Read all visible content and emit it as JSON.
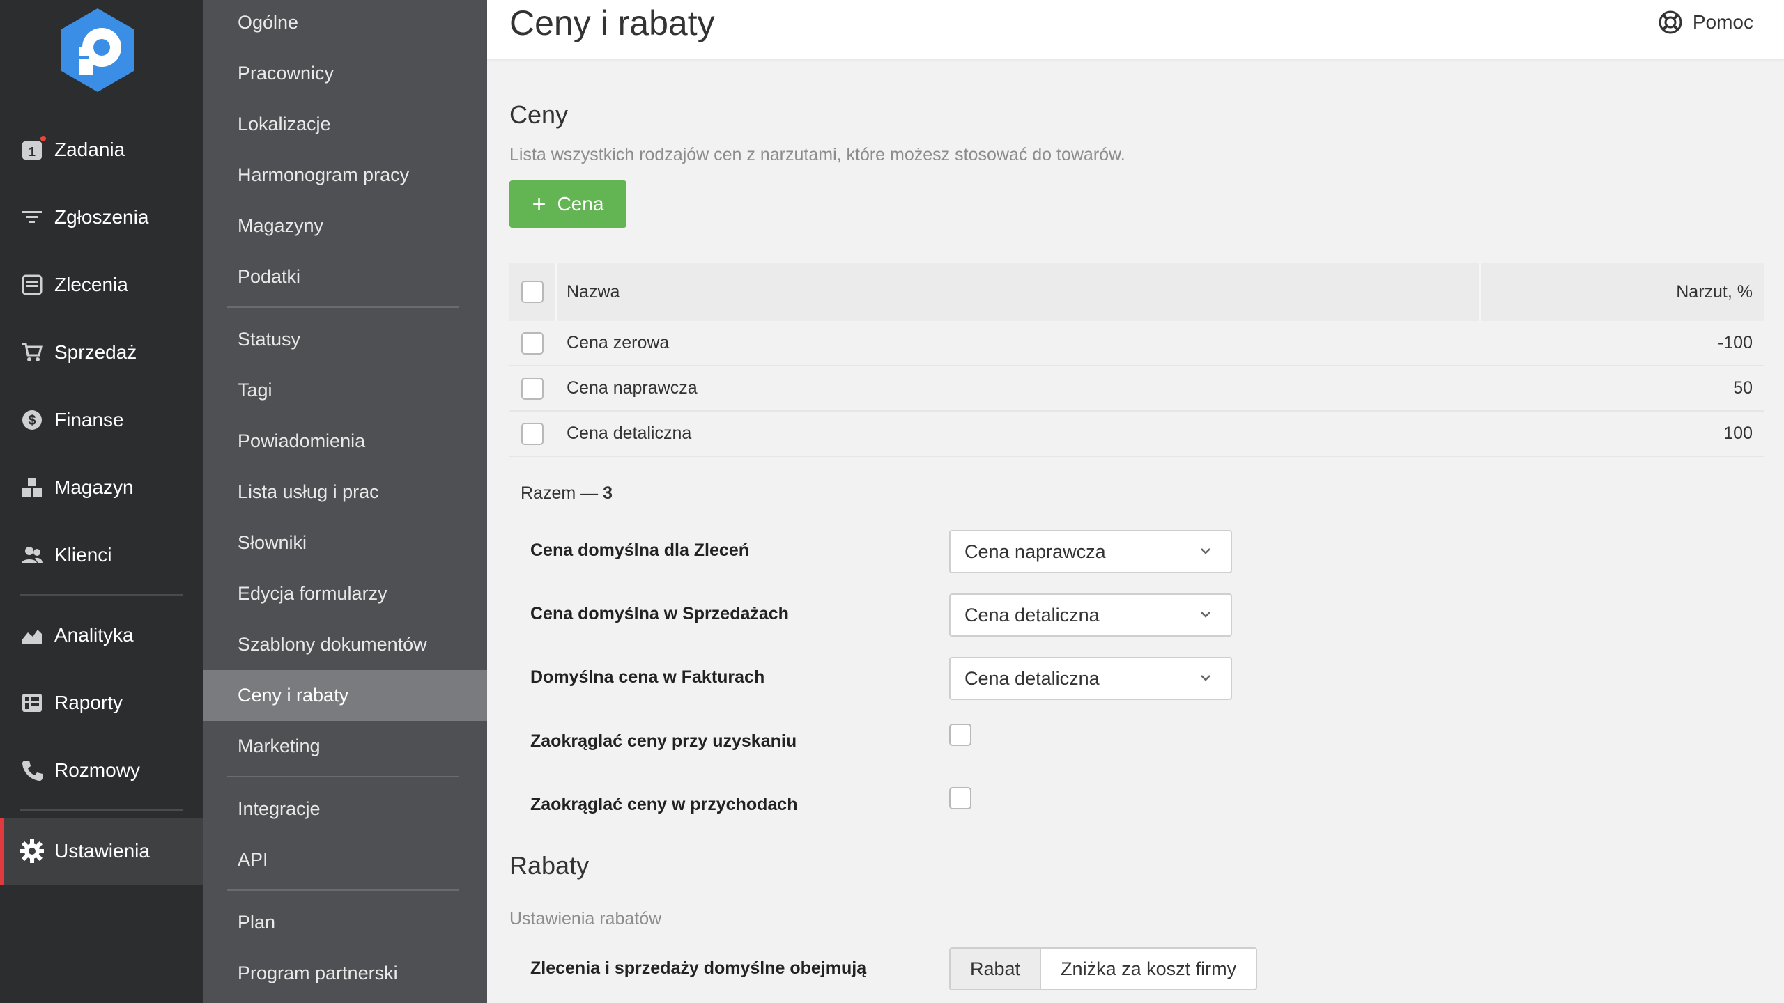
{
  "nav": {
    "items": [
      {
        "label": "Zadania",
        "icon": "tasks-icon",
        "badge": "1"
      },
      {
        "label": "Zgłoszenia",
        "icon": "funnel-icon"
      },
      {
        "label": "Zlecenia",
        "icon": "inbox-icon"
      },
      {
        "label": "Sprzedaż",
        "icon": "cart-icon"
      },
      {
        "label": "Finanse",
        "icon": "dollar-icon"
      },
      {
        "label": "Magazyn",
        "icon": "boxes-icon"
      },
      {
        "label": "Klienci",
        "icon": "users-icon"
      },
      {
        "label": "Analityka",
        "icon": "chart-area-icon"
      },
      {
        "label": "Raporty",
        "icon": "report-icon"
      },
      {
        "label": "Rozmowy",
        "icon": "phone-icon"
      },
      {
        "label": "Ustawienia",
        "icon": "gear-icon",
        "active": true
      }
    ]
  },
  "submenu": {
    "items": [
      "Ogólne",
      "Pracownicy",
      "Lokalizacje",
      "Harmonogram pracy",
      "Magazyny",
      "Podatki",
      "Statusy",
      "Tagi",
      "Powiadomienia",
      "Lista usług i prac",
      "Słowniki",
      "Edycja formularzy",
      "Szablony dokumentów",
      "Ceny i rabaty",
      "Marketing",
      "Integracje",
      "API",
      "Plan",
      "Program partnerski"
    ],
    "active": "Ceny i rabaty"
  },
  "header": {
    "title": "Ceny i rabaty",
    "help_label": "Pomoc"
  },
  "prices": {
    "title": "Ceny",
    "description": "Lista wszystkich rodzajów cen z narzutami, które możesz stosować do towarów.",
    "add_label": "Cena",
    "columns": {
      "name": "Nazwa",
      "markup": "Narzut, %"
    },
    "rows": [
      {
        "name": "Cena zerowa",
        "markup": "-100"
      },
      {
        "name": "Cena naprawcza",
        "markup": "50"
      },
      {
        "name": "Cena detaliczna",
        "markup": "100"
      }
    ],
    "total_label": "Razem —",
    "total_value": "3"
  },
  "settings": {
    "default_orders_label": "Cena domyślna dla Zleceń",
    "default_orders_value": "Cena naprawcza",
    "default_sales_label": "Cena domyślna w Sprzedażach",
    "default_sales_value": "Cena detaliczna",
    "default_invoices_label": "Domyślna cena w Fakturach",
    "default_invoices_value": "Cena detaliczna",
    "round_acquire_label": "Zaokrąglać ceny przy uzyskaniu",
    "round_income_label": "Zaokrąglać ceny w przychodach"
  },
  "discounts": {
    "title": "Rabaty",
    "description": "Ustawienia rabatów",
    "include_label": "Zlecenia i sprzedaży domyślne obejmują",
    "options": [
      "Rabat",
      "Zniżka za koszt firmy"
    ],
    "selected": "Rabat"
  },
  "colors": {
    "accent_green": "#63b554",
    "active_red": "#e0393e",
    "logo_blue": "#3a8ee6"
  }
}
